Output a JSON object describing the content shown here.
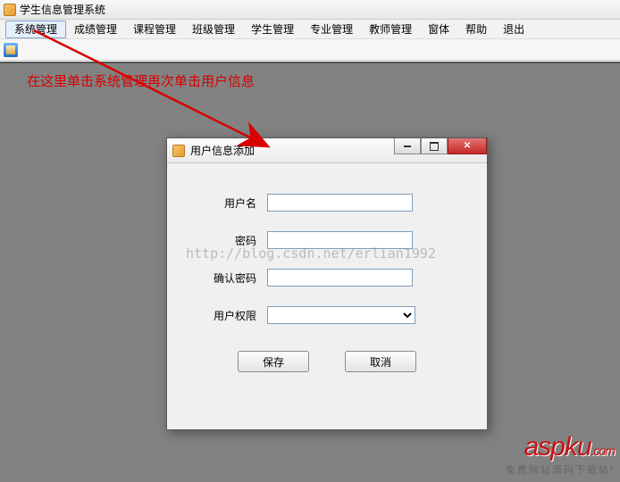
{
  "window": {
    "title": "学生信息管理系统"
  },
  "menu": {
    "items": [
      "系统管理",
      "成绩管理",
      "课程管理",
      "班级管理",
      "学生管理",
      "专业管理",
      "教师管理",
      "窗体",
      "帮助",
      "退出"
    ]
  },
  "annotation": "在这里单击系统管理再次单击用户信息",
  "dialog": {
    "title": "用户信息添加",
    "fields": {
      "username_label": "用户名",
      "password_label": "密码",
      "confirm_label": "确认密码",
      "role_label": "用户权限"
    },
    "buttons": {
      "save": "保存",
      "cancel": "取消"
    }
  },
  "watermark": "http://blog.csdn.net/erlian1992",
  "brand": {
    "name": "aspku",
    "suffix": ".com",
    "tagline": "免费网站源码下载站!"
  }
}
